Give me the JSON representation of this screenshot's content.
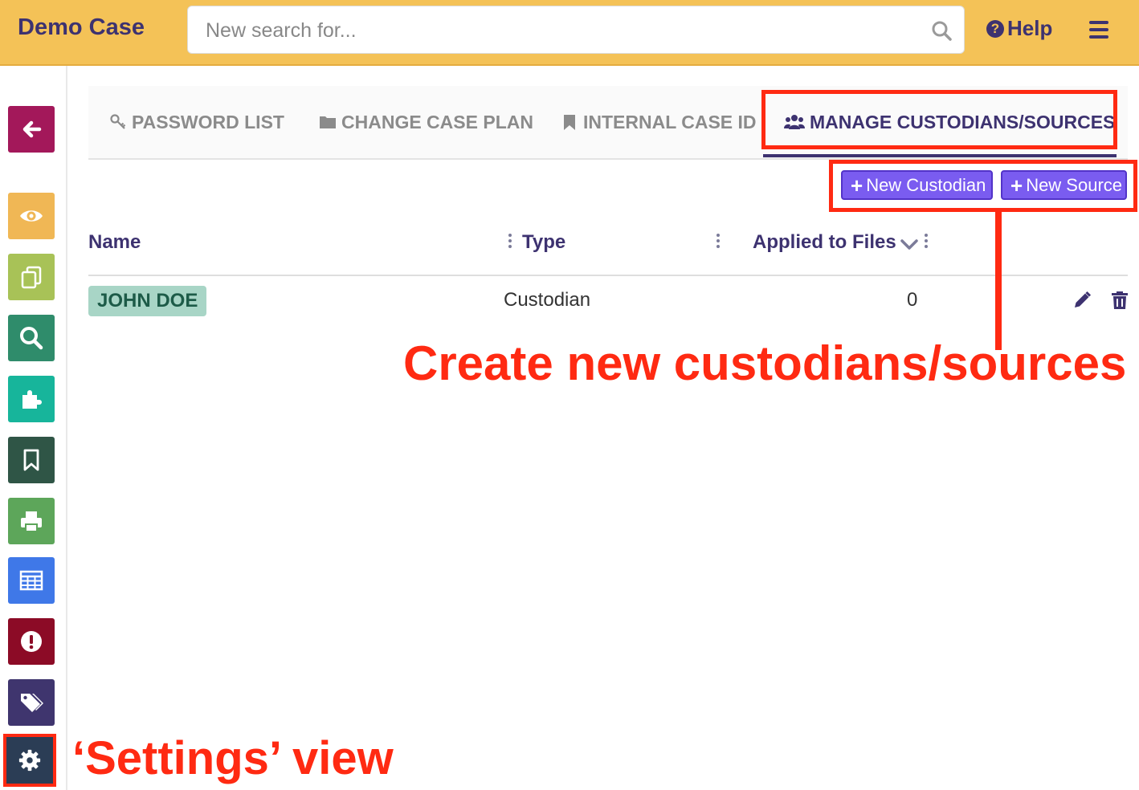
{
  "header": {
    "title": "Demo Case",
    "search_placeholder": "New search for...",
    "help_label": "Help"
  },
  "sidebar": {
    "items": [
      {
        "name": "back",
        "icon": "arrow-left-icon",
        "color": "#a3185a"
      },
      {
        "name": "view",
        "icon": "eye-icon",
        "color": "#f0b755"
      },
      {
        "name": "documents",
        "icon": "copy-icon",
        "color": "#a8c257"
      },
      {
        "name": "search",
        "icon": "search-icon",
        "color": "#2f8c6b"
      },
      {
        "name": "plugins",
        "icon": "puzzle-icon",
        "color": "#17b59b"
      },
      {
        "name": "bookmarks",
        "icon": "bookmark-icon",
        "color": "#2f5546"
      },
      {
        "name": "print",
        "icon": "print-icon",
        "color": "#5da65a"
      },
      {
        "name": "table",
        "icon": "table-icon",
        "color": "#3f78e8"
      },
      {
        "name": "alerts",
        "icon": "exclamation-icon",
        "color": "#8c0b26"
      },
      {
        "name": "tags",
        "icon": "tags-icon",
        "color": "#3f356e"
      },
      {
        "name": "settings",
        "icon": "gear-icon",
        "color": "#2b3d55"
      }
    ]
  },
  "tabs": [
    {
      "label": "PASSWORD LIST",
      "icon": "key-icon",
      "active": false
    },
    {
      "label": "CHANGE CASE PLAN",
      "icon": "folder-icon",
      "active": false
    },
    {
      "label": "INTERNAL CASE ID",
      "icon": "bookmark-icon",
      "active": false
    },
    {
      "label": "MANAGE CUSTODIANS/SOURCES",
      "icon": "users-icon",
      "active": true
    }
  ],
  "actions": {
    "new_custodian": "New Custodian",
    "new_source": "New Source"
  },
  "table": {
    "columns": [
      "Name",
      "Type",
      "Applied to Files"
    ],
    "rows": [
      {
        "name": "JOHN DOE",
        "type": "Custodian",
        "applied_to_files": "0"
      }
    ]
  },
  "annotations": {
    "create_note": "Create new custodians/sources",
    "settings_note": "‘Settings’ view"
  },
  "colors": {
    "header_bg": "#f4c257",
    "primary_text": "#3d3270",
    "button_bg": "#7a5cf0",
    "annotation_red": "#ff2a12",
    "badge_bg": "#a8d5c6"
  }
}
